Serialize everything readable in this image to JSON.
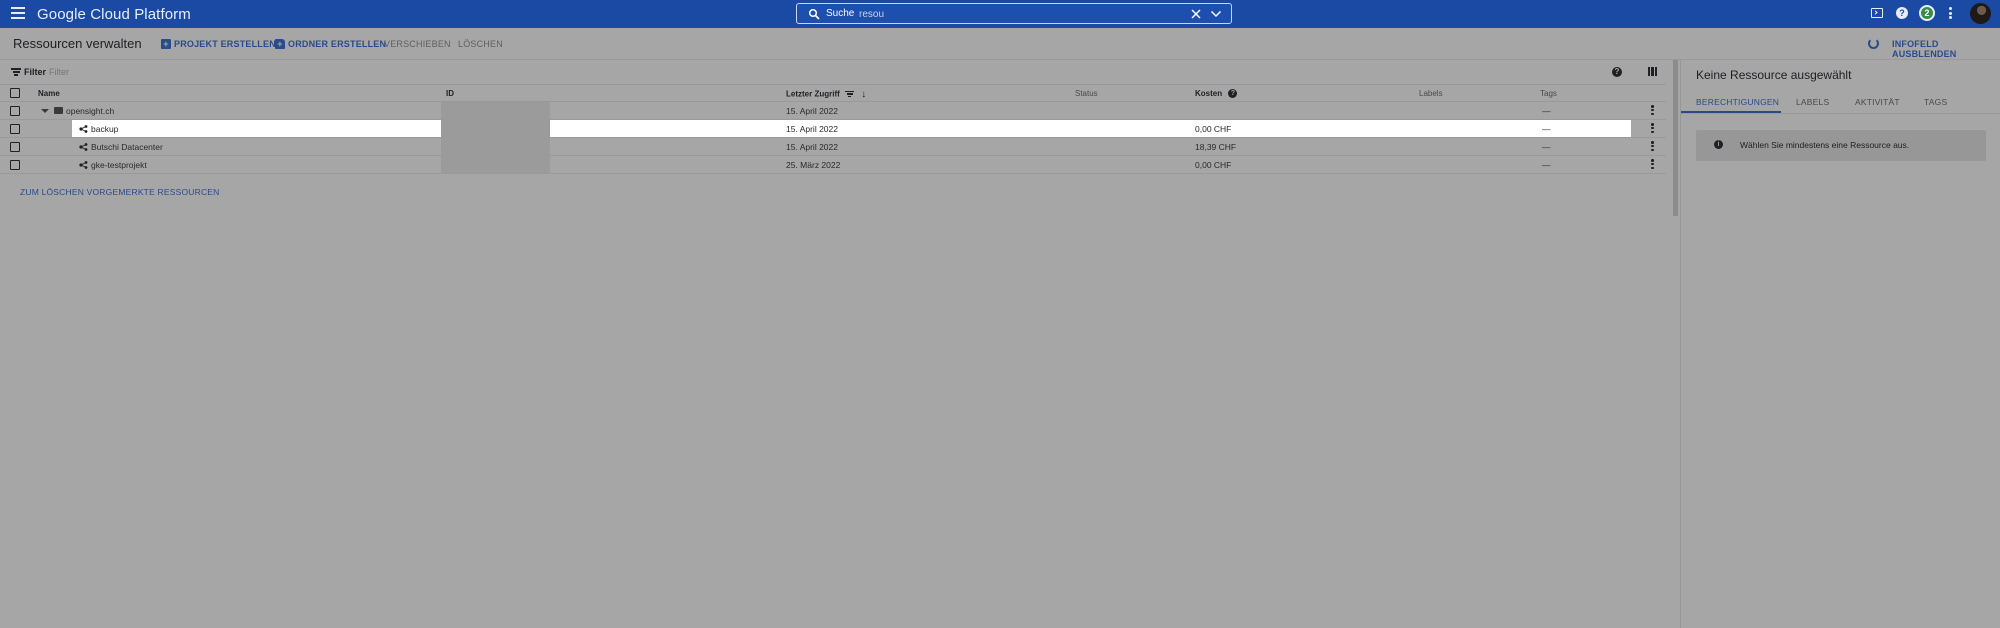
{
  "topbar": {
    "product_title": "Google Cloud Platform",
    "search_label": "Suche",
    "search_value": "resou",
    "notification_count": "2",
    "brand_color": "#1a4aa3"
  },
  "actionbar": {
    "page_title": "Ressourcen verwalten",
    "create_project": "PROJEKT ERSTELLEN",
    "create_folder": "ORDNER ERSTELLEN",
    "move": "VERSCHIEBEN",
    "delete": "LÖSCHEN",
    "hide_info": "INFOFELD AUSBLENDEN"
  },
  "filter": {
    "label": "Filter",
    "placeholder": "Filter"
  },
  "table": {
    "columns": {
      "name": "Name",
      "id": "ID",
      "last_access": "Letzter Zugriff",
      "status": "Status",
      "cost": "Kosten",
      "labels": "Labels",
      "tags": "Tags"
    },
    "rows": [
      {
        "name": "opensight.ch",
        "type": "organization",
        "last_access": "15. April 2022",
        "cost": "",
        "tags": "—"
      },
      {
        "name": "backup",
        "type": "project",
        "last_access": "15. April 2022",
        "cost": "0,00 CHF",
        "tags": "—"
      },
      {
        "name": "Butschi Datacenter",
        "type": "project",
        "last_access": "15. April 2022",
        "cost": "18,39 CHF",
        "tags": "—"
      },
      {
        "name": "gke-testprojekt",
        "type": "project",
        "last_access": "25. März 2022",
        "cost": "0,00 CHF",
        "tags": "—"
      }
    ],
    "deleted_link": "ZUM LÖSCHEN VORGEMERKTE RESSOURCEN"
  },
  "panel": {
    "title": "Keine Ressource ausgewählt",
    "tabs": [
      "BERECHTIGUNGEN",
      "LABELS",
      "AKTIVITÄT",
      "TAGS"
    ],
    "active_tab": "BERECHTIGUNGEN",
    "info_text": "Wählen Sie mindestens eine Ressource aus."
  }
}
